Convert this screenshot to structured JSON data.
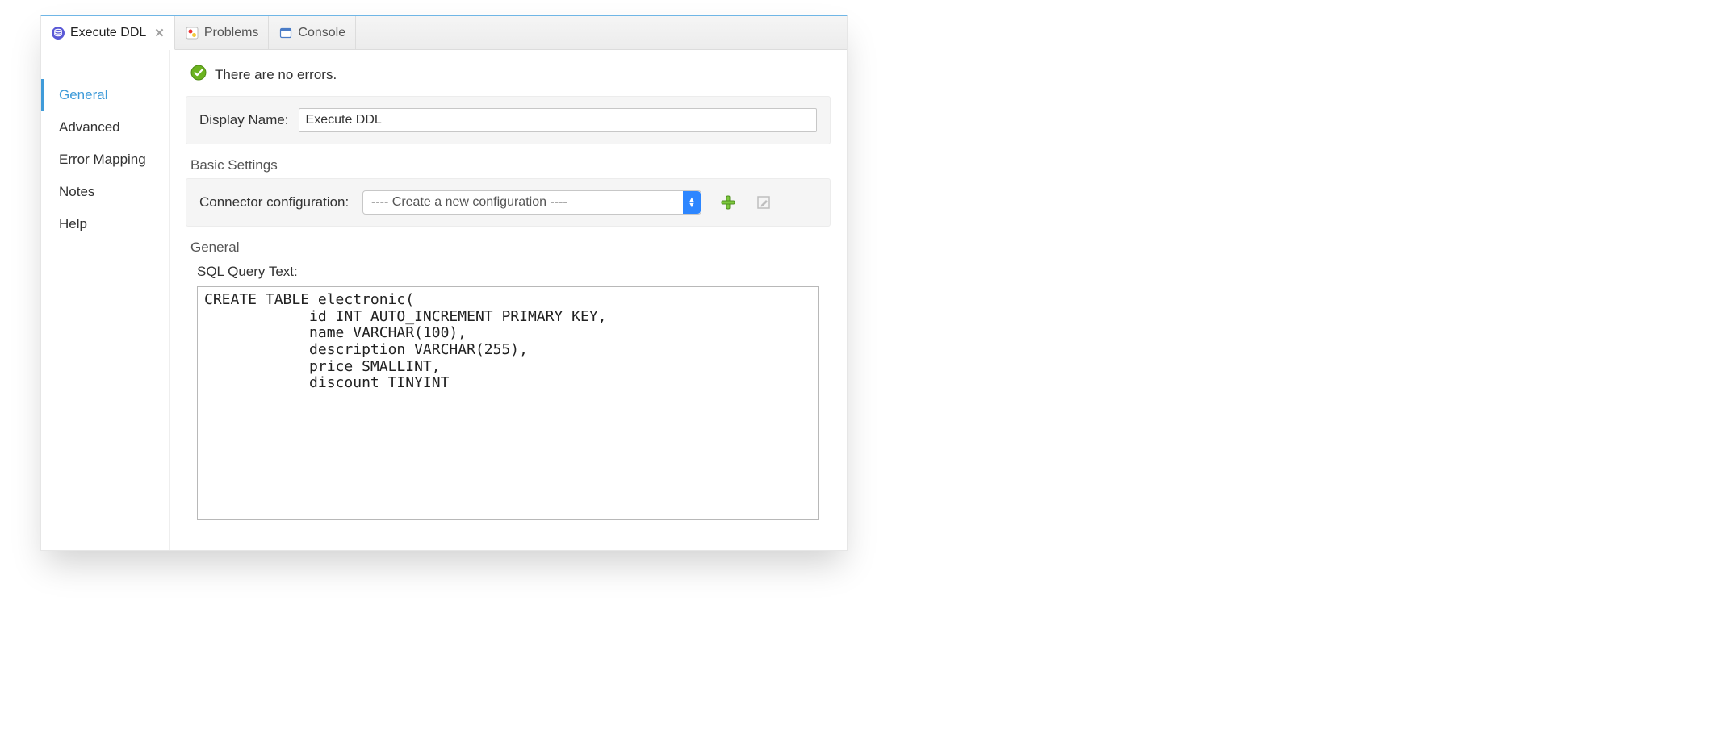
{
  "tabs": [
    {
      "label": "Execute DDL",
      "icon": "db-icon",
      "active": true,
      "closable": true
    },
    {
      "label": "Problems",
      "icon": "problems-icon",
      "active": false,
      "closable": false
    },
    {
      "label": "Console",
      "icon": "console-icon",
      "active": false,
      "closable": false
    }
  ],
  "sidebar": {
    "items": [
      "General",
      "Advanced",
      "Error Mapping",
      "Notes",
      "Help"
    ],
    "active_index": 0
  },
  "status": {
    "message": "There are no errors."
  },
  "display_name": {
    "label": "Display Name:",
    "value": "Execute DDL"
  },
  "basic_settings": {
    "title": "Basic Settings",
    "connector_label": "Connector configuration:",
    "connector_selected": "---- Create a new configuration ----"
  },
  "general_section": {
    "title": "General",
    "sql_label": "SQL Query Text:",
    "sql_value": "CREATE TABLE electronic(\n            id INT AUTO_INCREMENT PRIMARY KEY,\n            name VARCHAR(100),\n            description VARCHAR(255),\n            price SMALLINT,\n            discount TINYINT"
  }
}
